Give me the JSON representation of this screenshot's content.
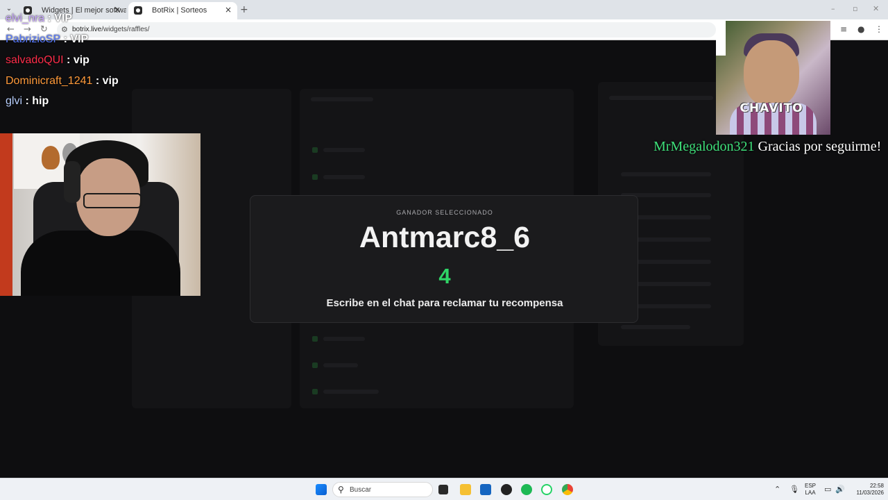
{
  "browser": {
    "tabs": [
      {
        "title": "Widgets | El mejor software pa",
        "active": false
      },
      {
        "title": "BotRix | Sorteos",
        "active": true
      }
    ],
    "url_domain": "botrix.live",
    "url_path": "/widgets/raffles/"
  },
  "chat": {
    "messages": [
      {
        "user": "elvi_nra",
        "text": ": VIP",
        "color": "#c9a8ff"
      },
      {
        "user": "PabrizioSP",
        "text": ": VIP",
        "color": "#5a7cff"
      },
      {
        "user": "salvadoQUI",
        "text": ": vip",
        "color": "#ff2d4a"
      },
      {
        "user": "Dominicraft_1241",
        "text": ": vip",
        "color": "#ff9a3a"
      },
      {
        "user": "glvi",
        "text": ": hip",
        "color": "#b9d0ff"
      }
    ]
  },
  "overlay": {
    "image_label": "CHAVITO",
    "follow_user": "MrMegalodon321",
    "follow_message": "Gracias por seguirme!"
  },
  "winner": {
    "label": "GANADOR SELECCIONADO",
    "name": "Antmarc8_6",
    "count": "4",
    "message": "Escribe en el chat para reclamar tu recompensa"
  },
  "taskbar": {
    "search_placeholder": "Buscar",
    "lang_top": "ESP",
    "lang_bottom": "LAA",
    "time": "22:58",
    "date": "11/03/2026"
  },
  "colors": {
    "accent_green": "#2fd566",
    "follow_green": "#3ee07a"
  },
  "icons": [
    "windows-start-icon",
    "search-icon",
    "task-view-icon",
    "file-explorer-icon",
    "store-icon",
    "obs-icon",
    "spotify-icon",
    "whatsapp-icon",
    "chrome-icon",
    "chevron-up-icon",
    "microphone-icon",
    "network-icon",
    "volume-icon"
  ]
}
